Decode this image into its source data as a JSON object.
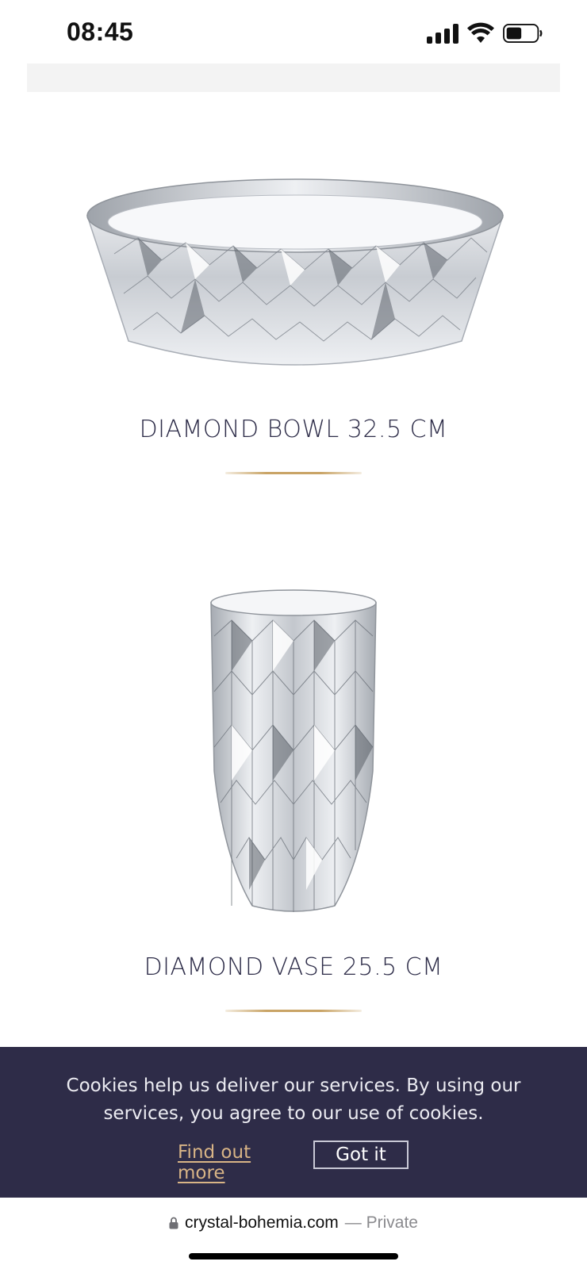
{
  "status_bar": {
    "time": "08:45",
    "icons": [
      "signal-icon",
      "wifi-icon",
      "battery-icon"
    ]
  },
  "products": [
    {
      "title": "DIAMOND BOWL 32.5 CM",
      "image_icon": "crystal-bowl"
    },
    {
      "title": "DIAMOND VASE 25.5 CM",
      "image_icon": "crystal-vase"
    }
  ],
  "cookie_banner": {
    "text": "Cookies help us deliver our services. By using our services, you agree to our use of cookies.",
    "find_out_more_label": "Find out more",
    "got_it_label": "Got it"
  },
  "address_bar": {
    "domain": "crystal-bohemia.com",
    "privacy": "— Private"
  },
  "colors": {
    "title_text": "#2d2c48",
    "accent_gold": "#c9a466",
    "banner_bg": "#2e2c48",
    "link_gold": "#d8b486"
  }
}
